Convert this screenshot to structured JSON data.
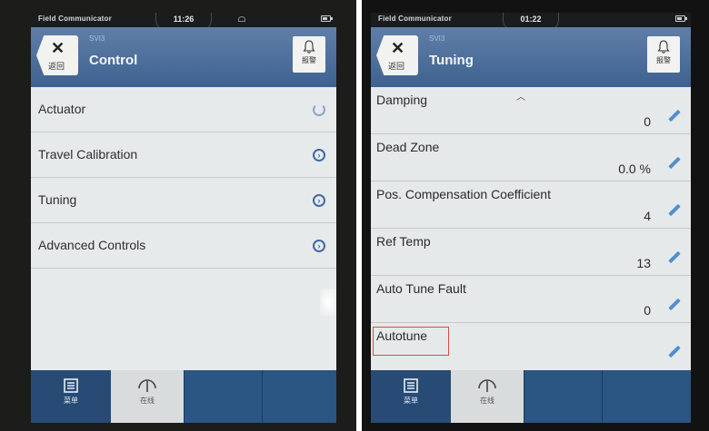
{
  "left": {
    "status": {
      "app": "Field Communicator",
      "time": "11:26"
    },
    "header": {
      "crumb": "SVI3",
      "title": "Control",
      "back_label": "返回",
      "alarm_label": "报警"
    },
    "menu": [
      {
        "label": "Actuator",
        "icon": "loading-spinner-icon"
      },
      {
        "label": "Travel Calibration",
        "icon": "chevron-right-circle-icon"
      },
      {
        "label": "Tuning",
        "icon": "chevron-right-circle-icon"
      },
      {
        "label": "Advanced Controls",
        "icon": "chevron-right-circle-icon"
      }
    ],
    "footer": {
      "menu_label": "菜单",
      "online_label": "在线"
    }
  },
  "right": {
    "status": {
      "app": "Field Communicator",
      "time": "01:22"
    },
    "header": {
      "crumb": "SVI3",
      "title": "Tuning",
      "back_label": "返回",
      "alarm_label": "报警"
    },
    "params": [
      {
        "name": "Damping",
        "value": "0"
      },
      {
        "name": "Dead Zone",
        "value": "0.0 %"
      },
      {
        "name": "Pos. Compensation Coefficient",
        "value": "4"
      },
      {
        "name": "Ref Temp",
        "value": "13"
      },
      {
        "name": "Auto Tune Fault",
        "value": "0"
      },
      {
        "name": "Autotune",
        "value": "",
        "highlighted": true
      }
    ],
    "footer": {
      "menu_label": "菜单",
      "online_label": "在线"
    }
  },
  "colors": {
    "header": "#4a6d99",
    "accent": "#3f6aa8",
    "highlight_box": "#e04a3e",
    "footer": "#2b5582"
  }
}
